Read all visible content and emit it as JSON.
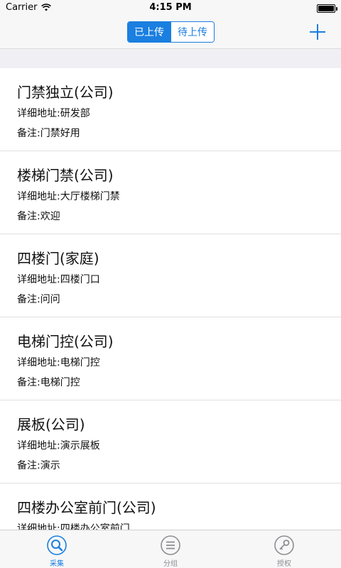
{
  "status_bar": {
    "carrier": "Carrier",
    "time": "4:15 PM"
  },
  "nav": {
    "segments": [
      {
        "label": "已上传",
        "selected": true
      },
      {
        "label": "待上传",
        "selected": false
      }
    ],
    "add_icon": "plus-icon"
  },
  "items": [
    {
      "title": "门禁独立(公司)",
      "address": "详细地址:研发部",
      "note": "备注:门禁好用"
    },
    {
      "title": "楼梯门禁(公司)",
      "address": "详细地址:大厅楼梯门禁",
      "note": "备注:欢迎"
    },
    {
      "title": "四楼门(家庭)",
      "address": "详细地址:四楼门口",
      "note": "备注:问问"
    },
    {
      "title": "电梯门控(公司)",
      "address": "详细地址:电梯门控",
      "note": "备注:电梯门控"
    },
    {
      "title": "展板(公司)",
      "address": "详细地址:演示展板",
      "note": "备注:演示"
    },
    {
      "title": "四楼办公室前门(公司)",
      "address": "详细地址:四楼办公室前门",
      "note": ""
    }
  ],
  "tabs": [
    {
      "label": "采集",
      "icon": "search-icon",
      "active": true
    },
    {
      "label": "分组",
      "icon": "list-icon",
      "active": false
    },
    {
      "label": "授权",
      "icon": "key-icon",
      "active": false
    }
  ],
  "colors": {
    "accent": "#1a7fe0",
    "inactive_tab": "#8e8e93",
    "band": "#efeff4"
  }
}
